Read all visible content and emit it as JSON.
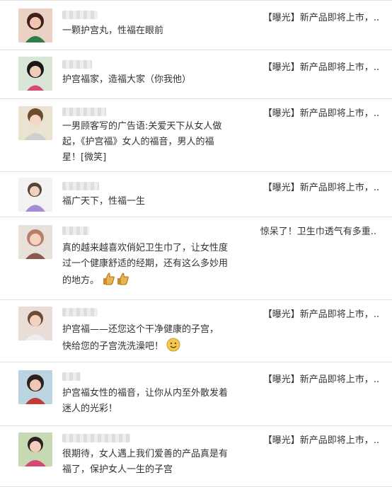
{
  "comments": [
    {
      "text": "一颗护宫丸，性福在眼前",
      "reply": "【曝光】新产品即将上市，..",
      "avatar": "woman-avatar"
    },
    {
      "text": "护宫福家，造福大家（你我他）",
      "reply": "【曝光】新产品即将上市，..",
      "avatar": "woman-avatar"
    },
    {
      "text": "一男顾客写的广告语:关爱天下从女人做起，《护宫福》女人的福音，男人的福星！[微笑]",
      "reply": "【曝光】新产品即将上市，..",
      "avatar": "woman-avatar"
    },
    {
      "text": "福广天下，性福一生",
      "reply": "【曝光】新产品即将上市，..",
      "avatar": "woman-avatar"
    },
    {
      "text": "真的越来越喜欢俏妃卫生巾了，让女性度过一个健康舒适的经期，还有这么多妙用的地方。",
      "reply": "惊呆了！卫生巾透气有多重..",
      "avatar": "woman-avatar",
      "emoji": [
        "thumbs-up-icon",
        "thumbs-up-icon"
      ]
    },
    {
      "text": "护宫福——还您这个干净健康的子宫，快给您的子宫洗洗澡吧！",
      "reply": "【曝光】新产品即将上市，..",
      "avatar": "woman-avatar",
      "emoji": [
        "smile-icon"
      ]
    },
    {
      "text": "护宫福女性的福音，让你从内至外散发着迷人的光彩！",
      "reply": "【曝光】新产品即将上市，..",
      "avatar": "woman-avatar"
    },
    {
      "text": "很期待，女人遇上我们爱善的产品真是有福了，保护女人一生的子宫",
      "reply": "【曝光】新产品即将上市，..",
      "avatar": "woman-avatar"
    }
  ],
  "colors": {
    "text": "#333333",
    "divider": "#e2e2e2",
    "thumbs": "#e8b64b",
    "smile": "#f2c94c"
  }
}
